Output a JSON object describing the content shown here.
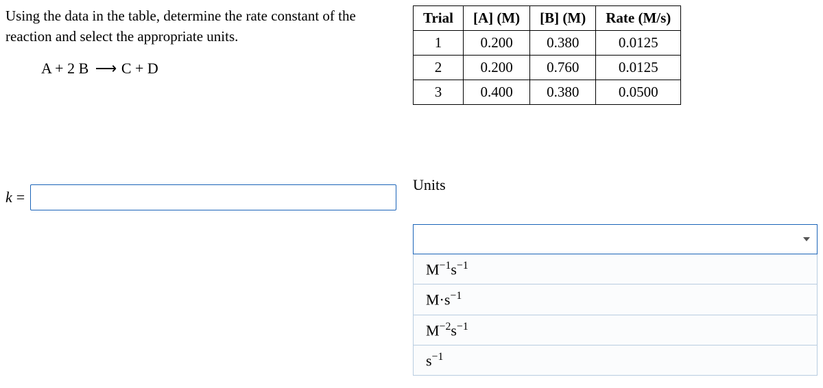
{
  "prompt": "Using the data in the table, determine the rate constant of the reaction and select the appropriate units.",
  "equation": "A + 2 B ⟶ C + D",
  "k_label": "k",
  "k_eq": "=",
  "k_value": "",
  "table": {
    "headers": [
      "Trial",
      "[A] (M)",
      "[B] (M)",
      "Rate (M/s)"
    ],
    "rows": [
      [
        "1",
        "0.200",
        "0.380",
        "0.0125"
      ],
      [
        "2",
        "0.200",
        "0.760",
        "0.0125"
      ],
      [
        "3",
        "0.400",
        "0.380",
        "0.0500"
      ]
    ]
  },
  "units_label": "Units",
  "units_selected": "",
  "units_options_html": [
    "M<sup>&minus;1</sup>s<sup>&minus;1</sup>",
    "M&middot;s<sup>&minus;1</sup>",
    "M<sup>&minus;2</sup>s<sup>&minus;1</sup>",
    "s<sup>&minus;1</sup>"
  ],
  "chart_data": {
    "type": "table",
    "title": "Reaction rate data",
    "columns": [
      "Trial",
      "[A] (M)",
      "[B] (M)",
      "Rate (M/s)"
    ],
    "rows": [
      [
        1,
        0.2,
        0.38,
        0.0125
      ],
      [
        2,
        0.2,
        0.76,
        0.0125
      ],
      [
        3,
        0.4,
        0.38,
        0.05
      ]
    ]
  }
}
